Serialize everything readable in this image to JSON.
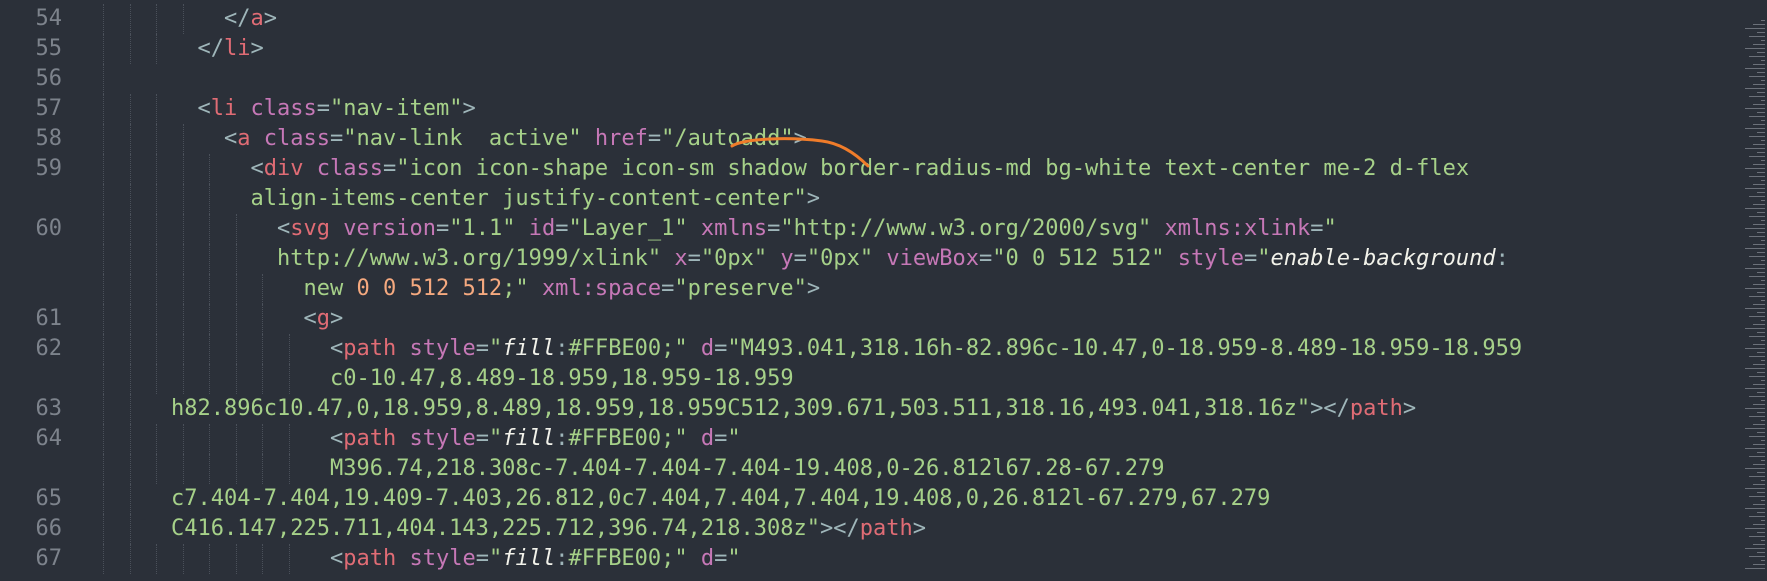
{
  "editor": {
    "lines": [
      {
        "num": "54",
        "indent": 4,
        "tokens": [
          [
            "punc",
            "</"
          ],
          [
            "tag",
            "a"
          ],
          [
            "punc",
            ">"
          ]
        ]
      },
      {
        "num": "55",
        "indent": 3,
        "tokens": [
          [
            "punc",
            "</"
          ],
          [
            "tag",
            "li"
          ],
          [
            "punc",
            ">"
          ]
        ]
      },
      {
        "num": "56",
        "indent": 0,
        "tokens": []
      },
      {
        "num": "57",
        "indent": 3,
        "tokens": [
          [
            "punc",
            "<"
          ],
          [
            "tag",
            "li"
          ],
          [
            "text",
            " "
          ],
          [
            "attr",
            "class"
          ],
          [
            "punc",
            "="
          ],
          [
            "str",
            "\"nav-item\""
          ],
          [
            "punc",
            ">"
          ]
        ]
      },
      {
        "num": "58",
        "indent": 4,
        "tokens": [
          [
            "punc",
            "<"
          ],
          [
            "tag",
            "a"
          ],
          [
            "text",
            " "
          ],
          [
            "attr",
            "class"
          ],
          [
            "punc",
            "="
          ],
          [
            "str",
            "\"nav-link  active\""
          ],
          [
            "text",
            " "
          ],
          [
            "attr",
            "href"
          ],
          [
            "punc",
            "="
          ],
          [
            "str",
            "\"/autoadd\""
          ],
          [
            "punc",
            ">"
          ]
        ]
      },
      {
        "num": "59",
        "indent": 5,
        "tokens": [
          [
            "punc",
            "<"
          ],
          [
            "tag",
            "div"
          ],
          [
            "text",
            " "
          ],
          [
            "attr",
            "class"
          ],
          [
            "punc",
            "="
          ],
          [
            "str",
            "\"icon icon-shape icon-sm shadow border-radius-md bg-white text-center me-2 d-flex"
          ]
        ]
      },
      {
        "num": "",
        "indent": 5,
        "tokens": [
          [
            "str",
            "align-items-center justify-content-center\""
          ],
          [
            "punc",
            ">"
          ]
        ]
      },
      {
        "num": "60",
        "indent": 6,
        "tokens": [
          [
            "punc",
            "<"
          ],
          [
            "tag",
            "svg"
          ],
          [
            "text",
            " "
          ],
          [
            "attr",
            "version"
          ],
          [
            "punc",
            "="
          ],
          [
            "str",
            "\"1.1\""
          ],
          [
            "text",
            " "
          ],
          [
            "attr",
            "id"
          ],
          [
            "punc",
            "="
          ],
          [
            "str",
            "\"Layer_1\""
          ],
          [
            "text",
            " "
          ],
          [
            "attr",
            "xmlns"
          ],
          [
            "punc",
            "="
          ],
          [
            "str",
            "\"http://www.w3.org/2000/svg\""
          ],
          [
            "text",
            " "
          ],
          [
            "attr",
            "xmlns:xlink"
          ],
          [
            "punc",
            "="
          ],
          [
            "str",
            "\""
          ]
        ]
      },
      {
        "num": "",
        "indent": 6,
        "tokens": [
          [
            "str",
            "http://www.w3.org/1999/xlink\""
          ],
          [
            "text",
            " "
          ],
          [
            "attr",
            "x"
          ],
          [
            "punc",
            "="
          ],
          [
            "str",
            "\"0px\""
          ],
          [
            "text",
            " "
          ],
          [
            "attr",
            "y"
          ],
          [
            "punc",
            "="
          ],
          [
            "str",
            "\"0px\""
          ],
          [
            "text",
            " "
          ],
          [
            "attr",
            "viewBox"
          ],
          [
            "punc",
            "="
          ],
          [
            "str",
            "\"0 0 512 512\""
          ],
          [
            "text",
            " "
          ],
          [
            "attr",
            "style"
          ],
          [
            "punc",
            "="
          ],
          [
            "str",
            "\""
          ],
          [
            "prop",
            "enable-background"
          ],
          [
            "punc",
            ":"
          ]
        ]
      },
      {
        "num": "",
        "indent": 7,
        "tokens": [
          [
            "str",
            "new "
          ],
          [
            "num",
            "0 0 512 512"
          ],
          [
            "str",
            ";\""
          ],
          [
            "text",
            " "
          ],
          [
            "attr",
            "xml:space"
          ],
          [
            "punc",
            "="
          ],
          [
            "str",
            "\"preserve\""
          ],
          [
            "punc",
            ">"
          ]
        ]
      },
      {
        "num": "61",
        "indent": 7,
        "tokens": [
          [
            "punc",
            "<"
          ],
          [
            "tag",
            "g"
          ],
          [
            "punc",
            ">"
          ]
        ]
      },
      {
        "num": "62",
        "indent": 8,
        "tokens": [
          [
            "punc",
            "<"
          ],
          [
            "tag",
            "path"
          ],
          [
            "text",
            " "
          ],
          [
            "attr",
            "style"
          ],
          [
            "punc",
            "="
          ],
          [
            "str",
            "\""
          ],
          [
            "prop",
            "fill"
          ],
          [
            "punc",
            ":"
          ],
          [
            "str",
            "#FFBE00;\""
          ],
          [
            "text",
            " "
          ],
          [
            "attr",
            "d"
          ],
          [
            "punc",
            "="
          ],
          [
            "str",
            "\"M493.041,318.16h-82.896c-10.47,0-18.959-8.489-18.959-18.959"
          ]
        ]
      },
      {
        "num": "",
        "indent": 8,
        "tokens": [
          [
            "str",
            "c0-10.47,8.489-18.959,18.959-18.959"
          ]
        ]
      },
      {
        "num": "63",
        "indent": 2,
        "tokens": [
          [
            "str",
            "h82.896c10.47,0,18.959,8.489,18.959,18.959C512,309.671,503.511,318.16,493.041,318.16z\""
          ],
          [
            "punc",
            "></"
          ],
          [
            "tag",
            "path"
          ],
          [
            "punc",
            ">"
          ]
        ]
      },
      {
        "num": "64",
        "indent": 8,
        "tokens": [
          [
            "punc",
            "<"
          ],
          [
            "tag",
            "path"
          ],
          [
            "text",
            " "
          ],
          [
            "attr",
            "style"
          ],
          [
            "punc",
            "="
          ],
          [
            "str",
            "\""
          ],
          [
            "prop",
            "fill"
          ],
          [
            "punc",
            ":"
          ],
          [
            "str",
            "#FFBE00;\""
          ],
          [
            "text",
            " "
          ],
          [
            "attr",
            "d"
          ],
          [
            "punc",
            "="
          ],
          [
            "str",
            "\""
          ]
        ]
      },
      {
        "num": "",
        "indent": 8,
        "tokens": [
          [
            "str",
            "M396.74,218.308c-7.404-7.404-7.404-19.408,0-26.812l67.28-67.279"
          ]
        ]
      },
      {
        "num": "65",
        "indent": 2,
        "tokens": [
          [
            "str",
            "c7.404-7.404,19.409-7.403,26.812,0c7.404,7.404,7.404,19.408,0,26.812l-67.279,67.279"
          ]
        ]
      },
      {
        "num": "66",
        "indent": 2,
        "tokens": [
          [
            "str",
            "C416.147,225.711,404.143,225.712,396.74,218.308z\""
          ],
          [
            "punc",
            "></"
          ],
          [
            "tag",
            "path"
          ],
          [
            "punc",
            ">"
          ]
        ]
      },
      {
        "num": "67",
        "indent": 8,
        "tokens": [
          [
            "punc",
            "<"
          ],
          [
            "tag",
            "path"
          ],
          [
            "text",
            " "
          ],
          [
            "attr",
            "style"
          ],
          [
            "punc",
            "="
          ],
          [
            "str",
            "\""
          ],
          [
            "prop",
            "fill"
          ],
          [
            "punc",
            ":"
          ],
          [
            "str",
            "#FFBE00;\""
          ],
          [
            "text",
            " "
          ],
          [
            "attr",
            "d"
          ],
          [
            "punc",
            "="
          ],
          [
            "str",
            "\""
          ]
        ]
      }
    ]
  },
  "colors": {
    "background": "#2b3039",
    "line_number": "#7d838c",
    "tag": "#e06c75",
    "attribute": "#c678b7",
    "string": "#a6d189",
    "number": "#f5a97f",
    "annotation_stroke": "#f07c2a"
  }
}
